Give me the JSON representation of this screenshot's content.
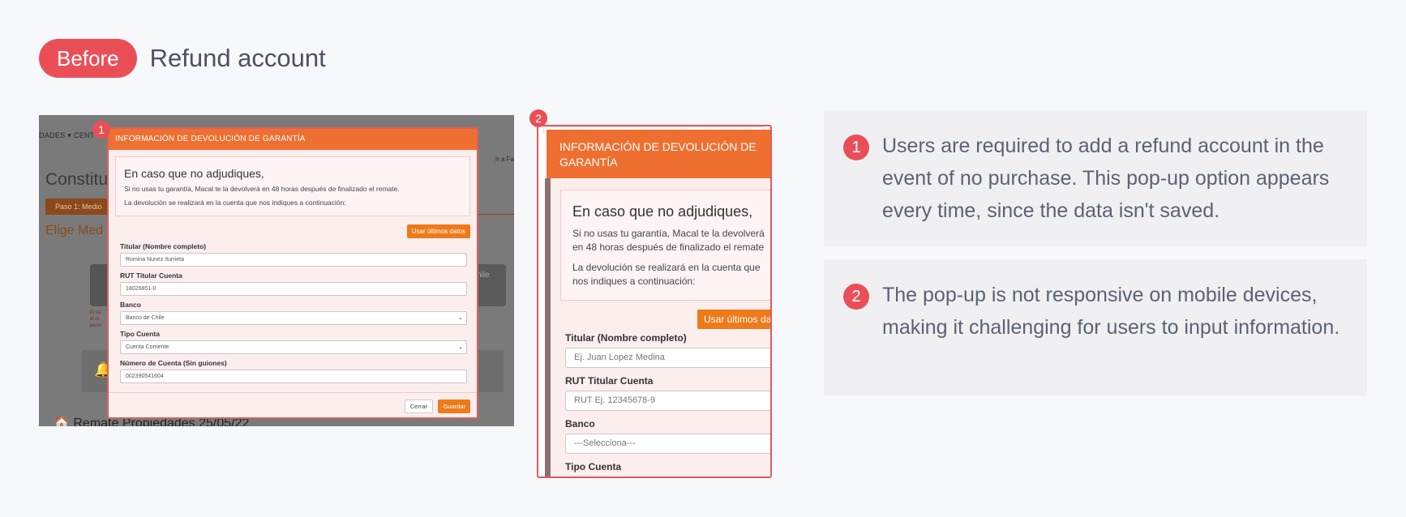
{
  "header": {
    "badge": "Before",
    "title": "Refund account"
  },
  "shot1": {
    "marker": "1",
    "background": {
      "nav": "DADES ▾   CENT",
      "ira": "Ir a Fa",
      "heading": "Constitu",
      "paso": "Paso 1: Medio",
      "elige": "Elige Med",
      "tile_right": "hile",
      "remate": "🏠 Remate Propiedades 25/05/22"
    },
    "modal": {
      "title": "INFORMACIÓN DE DEVOLUCIÓN DE GARANTÍA",
      "info_big": "En caso que no adjudiques,",
      "info_line1": "Si no usas tu garantía, Macal te la devolverá en 48 horas después de finalizado el remate.",
      "info_line2": "La devolución se realizará en la cuenta que nos indiques a continuación:",
      "use_last_button": "Usar últimos datos",
      "fields": [
        {
          "label": "Titular (Nombre completo)",
          "value": "Romina Nunez Iturrieta"
        },
        {
          "label": "RUT Titular Cuenta",
          "value": "18026851-0"
        },
        {
          "label": "Banco",
          "value": "Banco de Chile"
        },
        {
          "label": "Tipo Cuenta",
          "value": "Cuenta Corriente"
        },
        {
          "label": "Número de Cuenta (Sin guiones)",
          "value": "002390541604"
        }
      ],
      "close_button": "Cerrar",
      "save_button": "Guardar"
    }
  },
  "shot2": {
    "marker": "2",
    "title_line1": "INFORMACIÓN DE DEVOLUCIÓN DE",
    "title_line2": "GARANTÍA",
    "info_big": "En caso que no adjudiques,",
    "info_line1a": "Si no usas tu garantía, Macal te la devolverá",
    "info_line1b": "en 48 horas después de finalizado el remate",
    "info_line2a": "La devolución se realizará en la cuenta que",
    "info_line2b": "nos indiques a continuación:",
    "use_last_button": "Usar últimos datos",
    "fields": [
      {
        "label": "Titular (Nombre completo)",
        "placeholder": "Ej. Juan Lopez Medina"
      },
      {
        "label": "RUT Titular Cuenta",
        "placeholder": "RUT Ej. 12345678-9"
      },
      {
        "label": "Banco",
        "placeholder": "---Selecciona---"
      },
      {
        "label": "Tipo Cuenta",
        "placeholder": ""
      }
    ]
  },
  "notes": [
    {
      "number": "1",
      "text": "Users are required to add a refund account in the event of no purchase. This pop-up option appears every time, since the data isn't saved."
    },
    {
      "number": "2",
      "text": "The pop-up is not responsive on mobile devices, making it challenging for users to input information."
    }
  ],
  "colors": {
    "accent": "#ea4f57",
    "modal_header": "#ef6f31",
    "button": "#ee7a1a"
  }
}
